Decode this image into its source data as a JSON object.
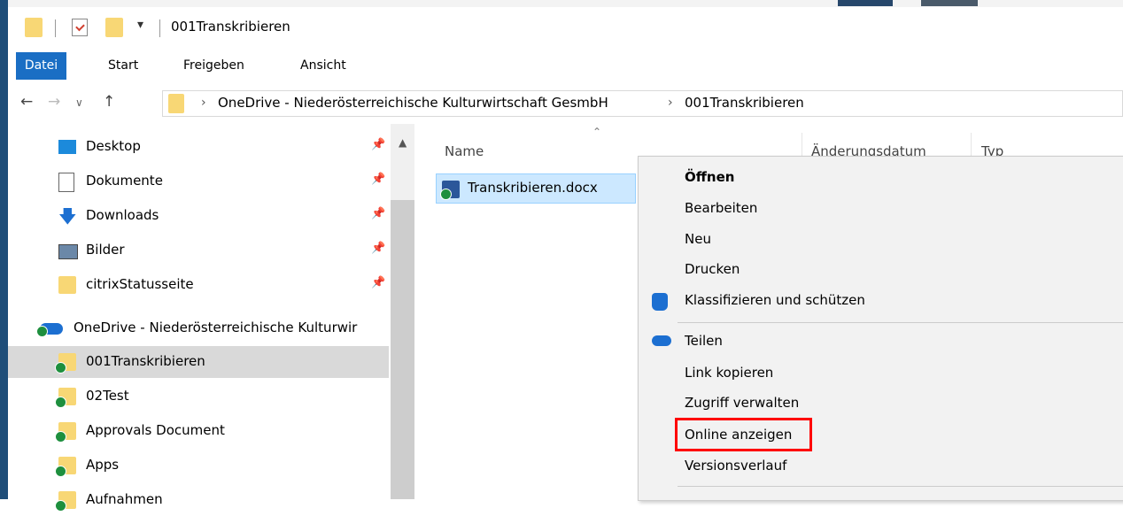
{
  "window": {
    "title": "001Transkribieren"
  },
  "quick_access_toolbar": {
    "dropdown_glyph": "▾"
  },
  "ribbon": {
    "tabs": [
      "Datei",
      "Start",
      "Freigeben",
      "Ansicht"
    ]
  },
  "address_bar": {
    "crumbs": [
      "OneDrive - Niederösterreichische Kulturwirtschaft GesmbH",
      "001Transkribieren"
    ]
  },
  "nav_pane": {
    "items": [
      {
        "label": "Desktop",
        "icon": "desktop-icon",
        "pinned": true
      },
      {
        "label": "Dokumente",
        "icon": "documents-icon",
        "pinned": true
      },
      {
        "label": "Downloads",
        "icon": "downloads-icon",
        "pinned": true
      },
      {
        "label": "Bilder",
        "icon": "pictures-icon",
        "pinned": true
      },
      {
        "label": "citrixStatusseite",
        "icon": "folder-icon",
        "pinned": true
      }
    ],
    "onedrive_root": "OneDrive - Niederösterreichische Kulturwir",
    "onedrive_items": [
      {
        "label": "001Transkribieren",
        "selected": true
      },
      {
        "label": "02Test"
      },
      {
        "label": "Approvals Document"
      },
      {
        "label": "Apps"
      },
      {
        "label": "Aufnahmen"
      }
    ]
  },
  "file_list": {
    "columns": [
      "Name",
      "Änderungsdatum",
      "Typ"
    ],
    "files": [
      {
        "name": "Transkribieren.docx",
        "icon": "word-doc-icon",
        "selected": true
      }
    ]
  },
  "context_menu": {
    "items": [
      {
        "label": "Öffnen",
        "bold": true
      },
      {
        "label": "Bearbeiten"
      },
      {
        "label": "Neu"
      },
      {
        "label": "Drucken"
      },
      {
        "label": "Klassifizieren und schützen",
        "icon": "shield-icon"
      },
      {
        "label": "Teilen",
        "icon": "onedrive-cloud-icon"
      },
      {
        "label": "Link kopieren"
      },
      {
        "label": "Zugriff verwalten"
      },
      {
        "label": "Online anzeigen",
        "highlighted": true
      },
      {
        "label": "Versionsverlauf"
      }
    ]
  },
  "colors": {
    "accent": "#1a6ec4",
    "selection": "#cce8ff",
    "highlight_box": "#ff0000",
    "folder": "#f8d775",
    "sync_ok": "#1e8f3e"
  }
}
